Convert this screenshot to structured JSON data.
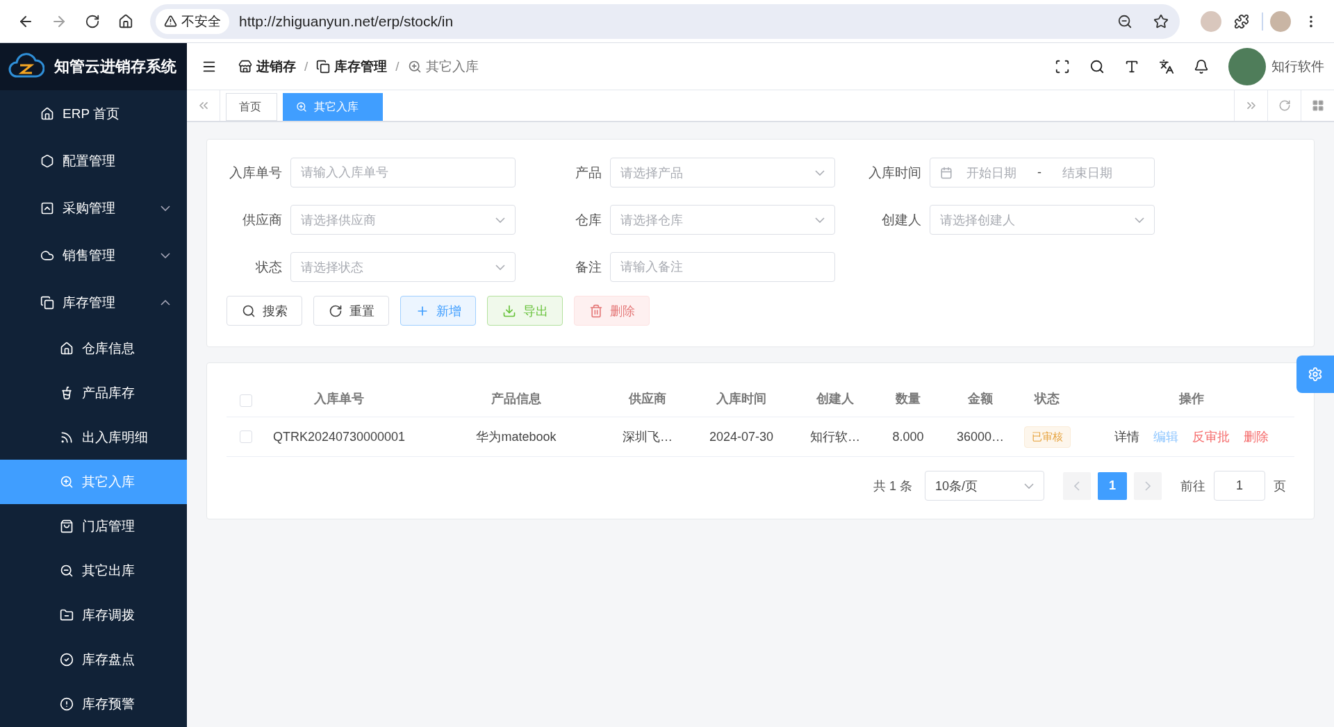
{
  "browser": {
    "forward_disabled": true,
    "security_label": "不安全",
    "url": "http://zhiguanyun.net/erp/stock/in"
  },
  "app": {
    "title": "知管云进销存系统",
    "user_name": "知行软件"
  },
  "breadcrumb": [
    {
      "label": "进销存",
      "current": false
    },
    {
      "separator": "/",
      "label": "库存管理",
      "current": false
    },
    {
      "separator": "/",
      "label": "其它入库",
      "current": true
    }
  ],
  "tabs": [
    {
      "label": "首页",
      "selected": false
    },
    {
      "label": "其它入库",
      "selected": true
    }
  ],
  "sidebar": {
    "items": [
      {
        "label": "ERP 首页",
        "selected": false
      },
      {
        "label": "配置管理",
        "selected": false
      },
      {
        "label": "采购管理",
        "selected": false,
        "expanded": false
      },
      {
        "label": "销售管理",
        "selected": false,
        "expanded": false
      },
      {
        "label": "库存管理",
        "selected": false,
        "expanded": true,
        "children": [
          {
            "label": "仓库信息",
            "selected": false
          },
          {
            "label": "产品库存",
            "selected": false
          },
          {
            "label": "出入库明细",
            "selected": false
          },
          {
            "label": "其它入库",
            "selected": true
          },
          {
            "label": "门店管理",
            "selected": false
          },
          {
            "label": "其它出库",
            "selected": false
          },
          {
            "label": "库存调拨",
            "selected": false
          },
          {
            "label": "库存盘点",
            "selected": false
          },
          {
            "label": "库存预警",
            "selected": false
          }
        ]
      }
    ]
  },
  "filters": [
    {
      "label": "入库单号",
      "kind": "input",
      "placeholder": "请输入入库单号"
    },
    {
      "label": "产品",
      "kind": "select",
      "placeholder": "请选择产品"
    },
    {
      "label": "入库时间",
      "kind": "daterange",
      "start_placeholder": "开始日期",
      "separator": "-",
      "end_placeholder": "结束日期"
    },
    {
      "label": "供应商",
      "kind": "select",
      "placeholder": "请选择供应商"
    },
    {
      "label": "仓库",
      "kind": "select",
      "placeholder": "请选择仓库"
    },
    {
      "label": "创建人",
      "kind": "select",
      "placeholder": "请选择创建人"
    },
    {
      "label": "状态",
      "kind": "select",
      "placeholder": "请选择状态"
    },
    {
      "label": "备注",
      "kind": "input",
      "placeholder": "请输入备注"
    }
  ],
  "actions": [
    {
      "label": "搜索",
      "kind": "search",
      "disabled": false
    },
    {
      "label": "重置",
      "kind": "reset",
      "disabled": false
    },
    {
      "label": "新增",
      "kind": "add",
      "disabled": false
    },
    {
      "label": "导出",
      "kind": "export",
      "disabled": false
    },
    {
      "label": "删除",
      "kind": "delete",
      "disabled": true
    }
  ],
  "table": {
    "header_checked": false,
    "columns": [
      "入库单号",
      "产品信息",
      "供应商",
      "入库时间",
      "创建人",
      "数量",
      "金额",
      "状态",
      "操作"
    ],
    "rows": [
      {
        "checked": false,
        "cells": [
          "QTRK20240730000001",
          "华为matebook",
          "深圳飞…",
          "2024-07-30",
          "知行软…",
          "8.000",
          "36000…"
        ],
        "status": "已审核",
        "actions": [
          {
            "label": "详情",
            "kind": "detail"
          },
          {
            "label": "编辑",
            "kind": "edit"
          },
          {
            "label": "反审批",
            "kind": "reject"
          },
          {
            "label": "删除",
            "kind": "delete"
          }
        ]
      }
    ]
  },
  "pagination": {
    "total": "共 1 条",
    "page_size": "10条/页",
    "prev_disabled": true,
    "next_disabled": true,
    "pages": [
      {
        "label": "1",
        "selected": true
      }
    ],
    "goto_label": "前往",
    "goto_value": "1",
    "page_suffix": "页"
  }
}
